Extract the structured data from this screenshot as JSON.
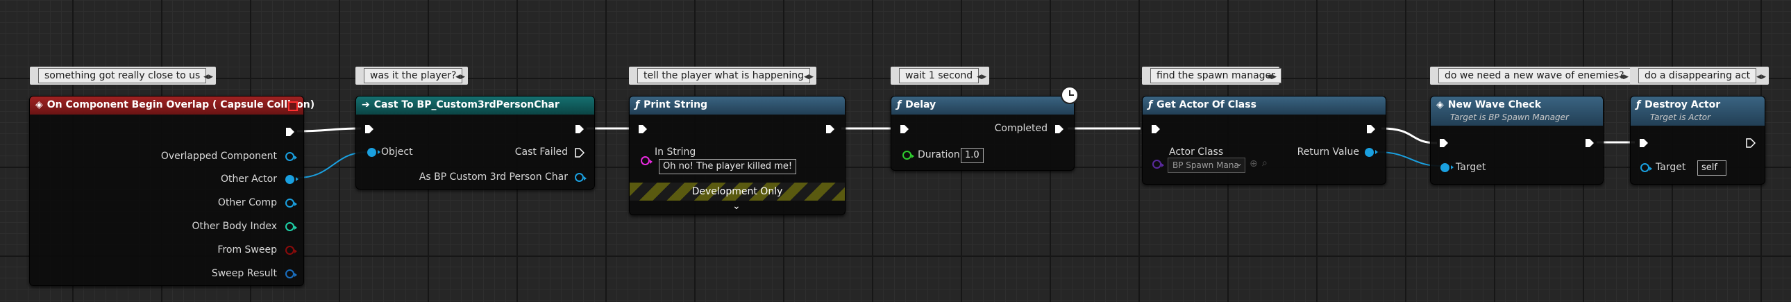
{
  "comments": {
    "overlap": "something got really close to us",
    "cast": "was it the player?",
    "print": "tell the player what is happening",
    "delay": "wait 1 second",
    "getactor": "find the spawn manager",
    "wave": "do we need a new wave of enemies?",
    "destroy": "do a disappearing act"
  },
  "nodes": {
    "overlap": {
      "title": "On Component Begin Overlap ( Capsule Collison)",
      "pins": [
        "Overlapped Component",
        "Other Actor",
        "Other Comp",
        "Other Body Index",
        "From Sweep",
        "Sweep Result"
      ]
    },
    "cast": {
      "title": "Cast To BP_Custom3rdPersonChar",
      "object": "Object",
      "cast_failed": "Cast Failed",
      "as_pin": "As BP Custom 3rd Person Char"
    },
    "print": {
      "title": "Print String",
      "in_string_label": "In String",
      "in_string_value": "Oh no! The player killed me!",
      "dev_only": "Development Only"
    },
    "delay": {
      "title": "Delay",
      "completed": "Completed",
      "duration_label": "Duration",
      "duration_value": "1.0"
    },
    "getactor": {
      "title": "Get Actor Of Class",
      "actor_class_label": "Actor Class",
      "actor_class_value": "BP Spawn Mana",
      "return_value": "Return Value"
    },
    "wave": {
      "title": "New Wave Check",
      "subtitle": "Target is BP Spawn Manager",
      "target": "Target"
    },
    "destroy": {
      "title": "Destroy Actor",
      "subtitle": "Target is Actor",
      "target": "Target",
      "target_value": "self"
    }
  },
  "colors": {
    "event_header": "#8a1a1a",
    "cast_header": "#0e5a5a",
    "function_header": "#2a4e66",
    "object_pin": "#1aa0e0",
    "struct_pin": "#1a6fc0",
    "int_pin": "#1fd0a8",
    "bool_pin": "#8a0b0b",
    "string_pin": "#ea2ae0",
    "float_pin": "#2ecc2e",
    "class_pin": "#5a2a9e"
  },
  "icons": {
    "event": "event-diamond-icon",
    "cast": "cast-arrow-icon",
    "function": "function-f-icon",
    "delay_clock": "clock-icon",
    "expand": "chevron-down-icon",
    "browse": "browse-icon",
    "search": "search-icon",
    "red_square": "stop-square-icon"
  }
}
